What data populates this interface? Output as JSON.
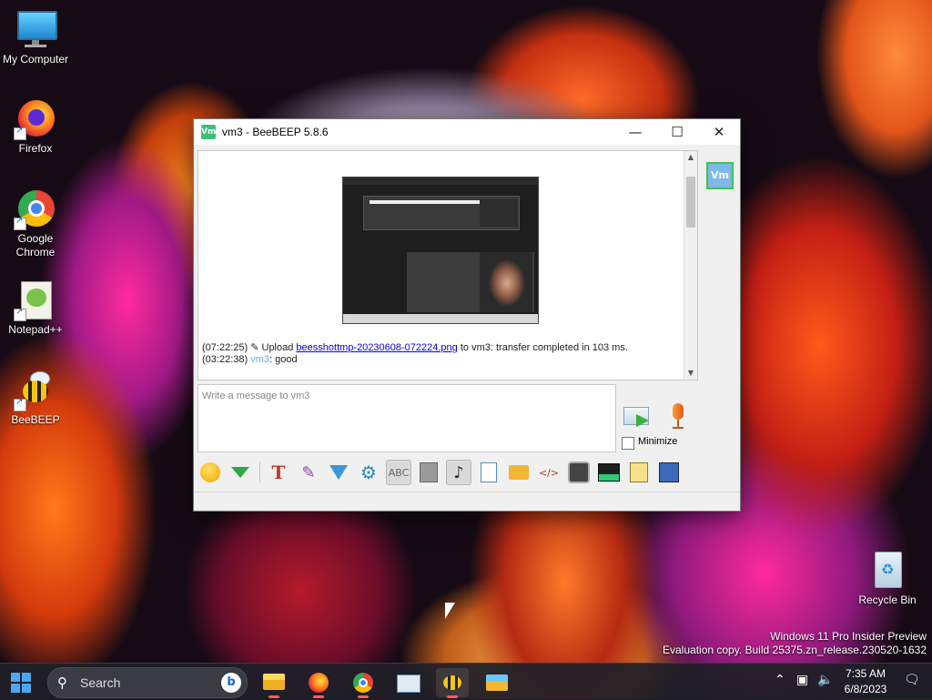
{
  "desktop": {
    "icons": [
      {
        "label": "My Computer"
      },
      {
        "label": "Firefox"
      },
      {
        "label": "Google Chrome"
      },
      {
        "label": "Notepad++"
      },
      {
        "label": "BeeBEEP"
      },
      {
        "label": "Recycle Bin"
      }
    ],
    "watermark_line1": "Windows 11 Pro Insider Preview",
    "watermark_line2": "Evaluation copy. Build 25375.zn_release.230520-1632"
  },
  "window": {
    "title": "vm3 - BeeBEEP 5.8.6",
    "app_icon_text": "Vm",
    "minimize_symbol": "—",
    "maximize_symbol": "☐",
    "close_symbol": "✕",
    "messages": [
      {
        "time": "(07:22:25)",
        "prefix": " Upload ",
        "link": "beesshottmp-20230608-072224.png",
        "suffix": " to vm3: transfer completed in 103 ms."
      },
      {
        "time": "(03:22:38)",
        "user": "vm3",
        "text": ": good"
      }
    ],
    "input_placeholder": "Write a message to vm3",
    "minimize_label": "Minimize",
    "minimize_checked": false,
    "user_avatar": "Vm",
    "toolbar_icons": [
      "emoticon-icon",
      "download-arrow-icon",
      "text-font-icon",
      "color-pencils-icon",
      "filter-icon",
      "settings-gear-icon",
      "spellcheck-icon",
      "word-complete-icon",
      "music-note-icon",
      "file-send-icon",
      "folder-send-icon",
      "html-code-icon",
      "camera-icon",
      "screenshot-icon",
      "notes-icon",
      "save-icon"
    ]
  },
  "taskbar": {
    "search_label": "Search",
    "time": "7:35 AM",
    "date": "6/8/2023",
    "apps": [
      "file-explorer",
      "firefox",
      "chrome",
      "task-manager",
      "beebeep",
      "folder"
    ]
  }
}
